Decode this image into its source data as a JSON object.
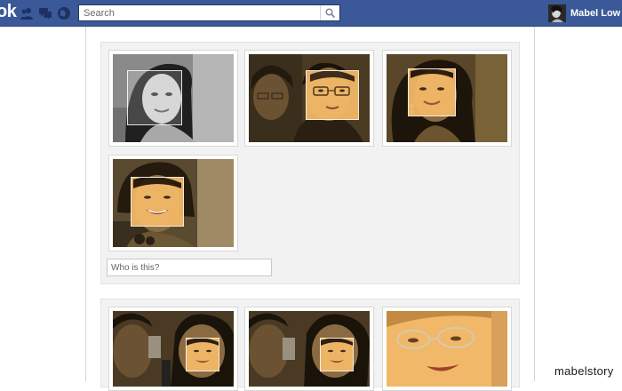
{
  "header": {
    "logo_text": "ok",
    "search": {
      "placeholder": "Search",
      "value": ""
    },
    "profile_name": "Mabel Low",
    "icons": [
      "friend-requests-icon",
      "messages-icon",
      "notifications-icon",
      "search-icon"
    ]
  },
  "tagging": {
    "input_placeholder": "Who is this?"
  },
  "watermark": "mabelstory",
  "colors": {
    "topbar": "#3b5998",
    "panel": "#f2f2f2",
    "face_overlay": "#f5b867"
  }
}
